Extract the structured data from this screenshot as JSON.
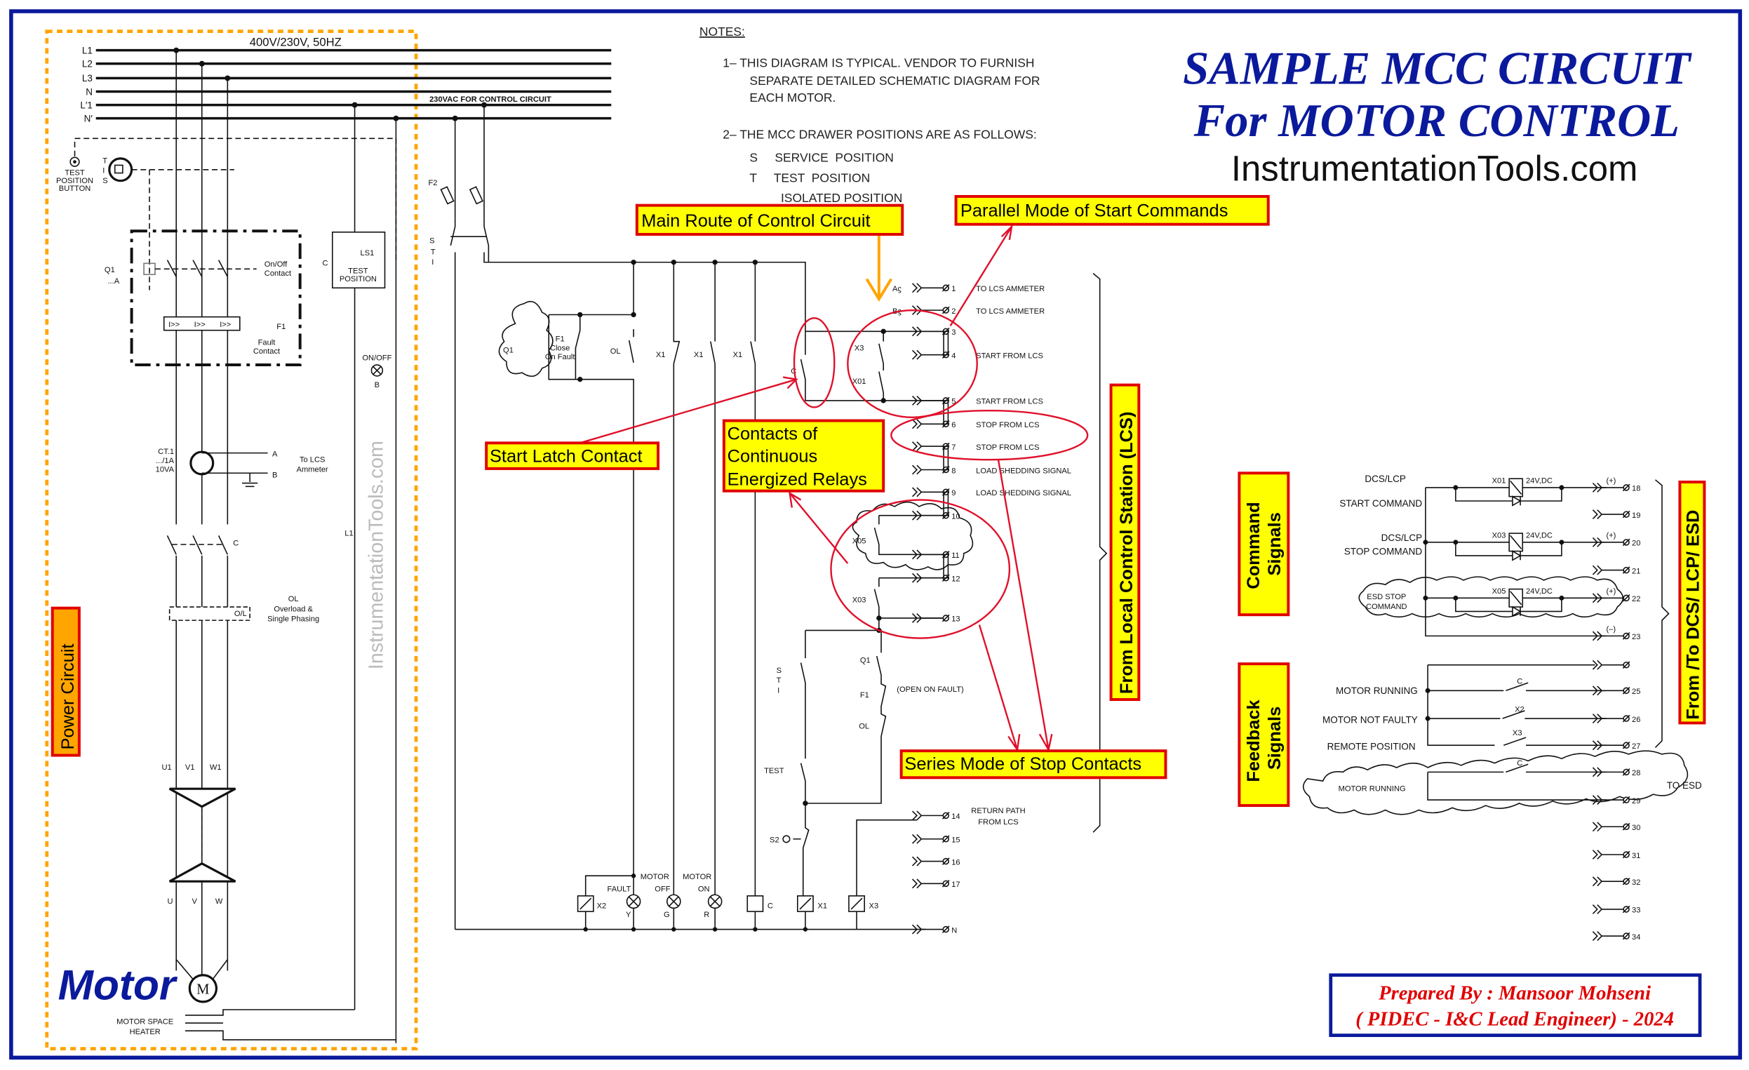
{
  "title": {
    "line1": "SAMPLE MCC CIRCUIT",
    "line2": "For MOTOR CONTROL",
    "website": "InstrumentationTools.com",
    "color": "#0b1a9c"
  },
  "notes": {
    "heading": "NOTES:",
    "lines": [
      "1–  THIS DIAGRAM IS TYPICAL. VENDOR TO FURNISH",
      "SEPARATE DETAILED SCHEMATIC DIAGRAM FOR",
      "EACH MOTOR.",
      "2–  THE MCC DRAWER POSITIONS ARE AS FOLLOWS:",
      "S     SERVICE  POSITION",
      "T     TEST  POSITION",
      "ISOLATED  POSITION"
    ]
  },
  "power": {
    "bus_labels": [
      "L1",
      "L2",
      "L3",
      "N",
      "L′1",
      "N′"
    ],
    "supply": "400V/230V, 50HZ",
    "control_supply": "230VAC FOR CONTROL CIRCUIT",
    "test_button": [
      "TEST",
      "POSITION",
      "BUTTON"
    ],
    "selector": [
      "T",
      "I",
      "S"
    ],
    "q1": [
      "Q1",
      "...A"
    ],
    "on_off_contact": [
      "On/Off",
      "Contact"
    ],
    "trip_units": [
      "I>>",
      "I>>",
      "I>>"
    ],
    "f1": "F1",
    "fault_contact": [
      "Fault",
      "Contact"
    ],
    "ls1": "LS1",
    "ls1_c": "C",
    "test_position": [
      "TEST",
      "POSITION"
    ],
    "on_off_lamp": [
      "ON/OFF",
      "B"
    ],
    "ct": [
      "CT.1",
      ".../1A",
      "10VA"
    ],
    "ct_terminals": [
      "A",
      "B"
    ],
    "to_lcs": [
      "To LCS",
      "Ammeter"
    ],
    "contactor": "C",
    "overload": [
      "OL",
      "Overload  &",
      "Single  Phasing"
    ],
    "ol_tag": "O/L",
    "l1_tag": "L1",
    "drawer_terminals": [
      "U1",
      "V1",
      "W1"
    ],
    "motor_terminals": [
      "U",
      "V",
      "W"
    ],
    "motor_symbol": "M",
    "motor_label": "Motor",
    "heater": [
      "MOTOR  SPACE",
      "HEATER"
    ],
    "section_label": "Power Circuit",
    "watermark": "InstrumentationTools.com"
  },
  "control": {
    "f2": "F2",
    "sti": [
      "S",
      "T",
      "I"
    ],
    "q1": "Q1",
    "f1_close": [
      "F1",
      "Close",
      "On  Fault"
    ],
    "ol": "OL",
    "x1": [
      "X1",
      "X1",
      "X1"
    ],
    "c": "C",
    "x3": "X3",
    "x01": "X01",
    "x05": "X05",
    "x03": "X03",
    "stop_q1": "Q1",
    "stop_f1": "F1",
    "open_on_fault": "(OPEN  ON  FAULT)",
    "stop_ol": "OL",
    "test": "TEST",
    "s2": "S2",
    "coils": {
      "x2": "X2",
      "c": "C",
      "x1": "X1",
      "x3": "X3"
    },
    "lamps": [
      {
        "top": "",
        "name": "FAULT",
        "color": "Y"
      },
      {
        "top": "MOTOR",
        "name": "OFF",
        "color": "G"
      },
      {
        "top": "MOTOR",
        "name": "ON",
        "color": "R"
      }
    ],
    "return_path": [
      "RETURN  PATH",
      "FROM  LCS"
    ],
    "neutral_terminal": "N"
  },
  "lcs_terminals": [
    {
      "num": "1",
      "prefix": "A",
      "label": "TO  LCS  AMMETER"
    },
    {
      "num": "2",
      "prefix": "B",
      "label": "TO  LCS  AMMETER"
    },
    {
      "num": "3",
      "prefix": "",
      "label": ""
    },
    {
      "num": "4",
      "prefix": "",
      "label": "START  FROM  LCS"
    },
    {
      "num": "5",
      "prefix": "",
      "label": "START  FROM  LCS"
    },
    {
      "num": "6",
      "prefix": "",
      "label": "STOP  FROM  LCS"
    },
    {
      "num": "7",
      "prefix": "",
      "label": "STOP  FROM  LCS"
    },
    {
      "num": "8",
      "prefix": "",
      "label": "LOAD  SHEDDING  SIGNAL"
    },
    {
      "num": "9",
      "prefix": "",
      "label": "LOAD  SHEDDING  SIGNAL"
    },
    {
      "num": "10",
      "prefix": "",
      "label": ""
    },
    {
      "num": "11",
      "prefix": "",
      "label": ""
    },
    {
      "num": "12",
      "prefix": "",
      "label": ""
    },
    {
      "num": "13",
      "prefix": "",
      "label": ""
    },
    {
      "num": "14",
      "prefix": "",
      "label": ""
    },
    {
      "num": "15",
      "prefix": "",
      "label": ""
    },
    {
      "num": "16",
      "prefix": "",
      "label": ""
    },
    {
      "num": "17",
      "prefix": "",
      "label": ""
    }
  ],
  "dcs": {
    "start": [
      "DCS/LCP",
      "START  COMMAND"
    ],
    "stop": [
      "DCS/LCP",
      "STOP  COMMAND"
    ],
    "esd": [
      "ESD  STOP",
      "COMMAND"
    ],
    "relays": [
      "X01",
      "X03",
      "X05"
    ],
    "relay_voltage": "24V,DC",
    "plus": "(+)",
    "minus": "(–)",
    "feedback": [
      "MOTOR  RUNNING",
      "MOTOR  NOT  FAULTY",
      "REMOTE  POSITION"
    ],
    "feedback_contacts": [
      "C",
      "X2",
      "X3",
      "C"
    ],
    "esd_running": "MOTOR  RUNNING",
    "to_esd": "TO  ESD",
    "terminals": [
      "18",
      "19",
      "20",
      "21",
      "22",
      "23",
      "",
      "25",
      "26",
      "27",
      "28",
      "29",
      "30",
      "31",
      "32",
      "33",
      "34"
    ]
  },
  "section_labels": {
    "lcs": "From Local Control Station (LCS)",
    "command": [
      "Command",
      "Signals"
    ],
    "feedback": [
      "Feedback",
      "Signals"
    ],
    "dcs": "From /To DCS/ LCP/ ESD"
  },
  "annotations": {
    "main_route": "Main Route of Control Circuit",
    "parallel_start": "Parallel Mode of Start Commands",
    "start_latch": "Start Latch Contact",
    "continuous": [
      "Contacts of",
      "Continuous",
      "Energized Relays"
    ],
    "series_stop": "Series Mode of Stop Contacts"
  },
  "credit": {
    "line1": "Prepared By : Mansoor Mohseni",
    "line2": "( PIDEC - I&C Lead Engineer) - 2024",
    "color": "#e00000"
  },
  "colors": {
    "frame": "#0b1a9c",
    "power_box": "#ffa500",
    "highlight": "#ffff00",
    "annotation_border": "#e00000"
  }
}
